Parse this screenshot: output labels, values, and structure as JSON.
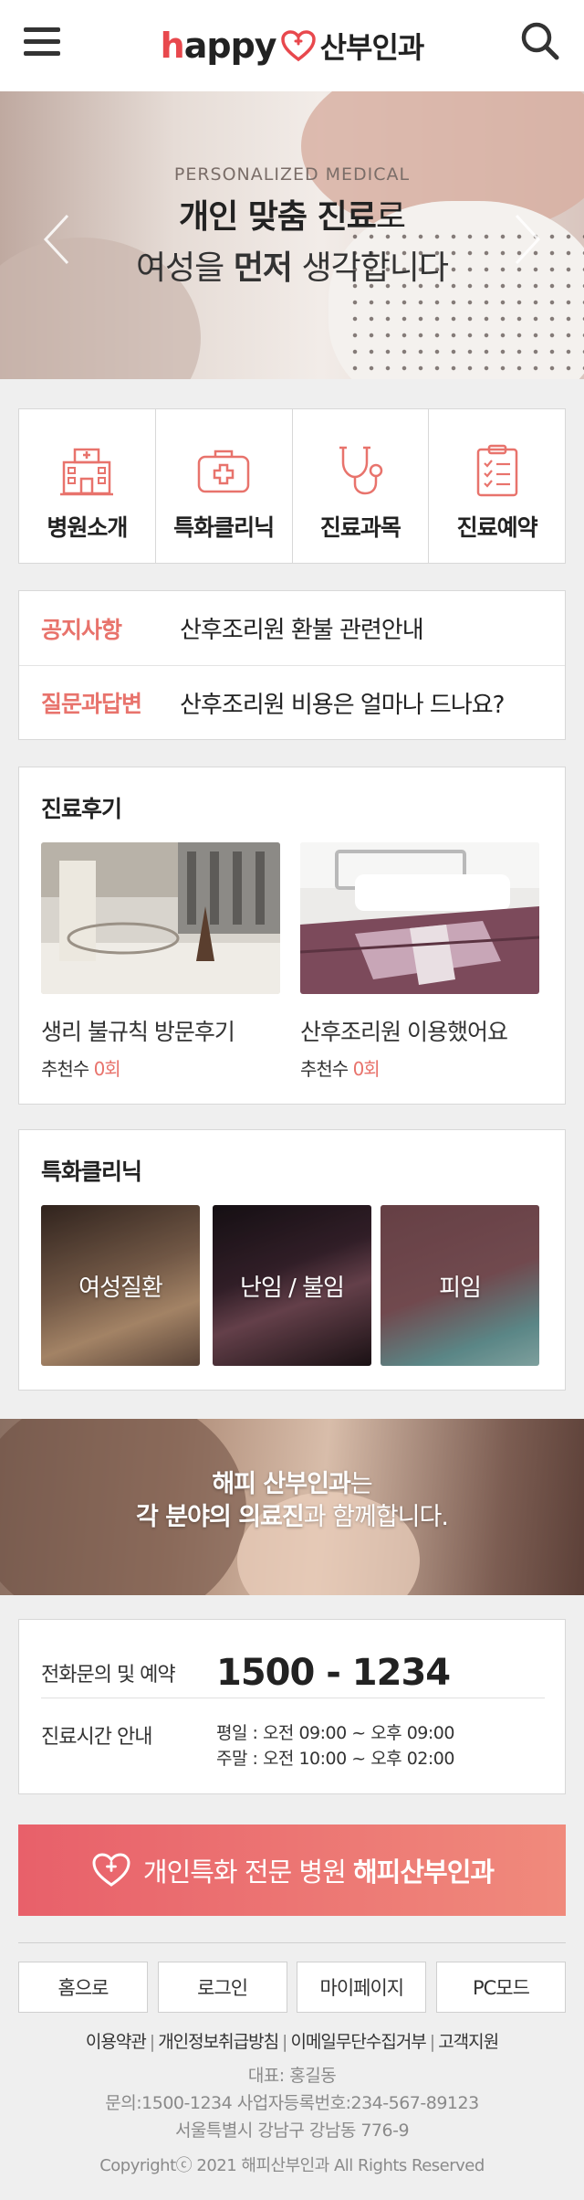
{
  "header": {
    "logo_happy_h": "h",
    "logo_happy_rest": "appy",
    "logo_ko": "산부인과"
  },
  "hero": {
    "subtitle": "PERSONALIZED MEDICAL",
    "line1_bold": "개인 맞춤 진료",
    "line1_rest": "로",
    "line2_a": "여성을 ",
    "line2_bold": "먼저",
    "line2_b": " 생각합니다"
  },
  "quick_menu": [
    {
      "label": "병원소개",
      "icon": "hospital-icon"
    },
    {
      "label": "특화클리닉",
      "icon": "medical-kit-icon"
    },
    {
      "label": "진료과목",
      "icon": "stethoscope-icon"
    },
    {
      "label": "진료예약",
      "icon": "clipboard-icon"
    }
  ],
  "notices": [
    {
      "tag": "공지사항",
      "text": "산후조리원 환불 관련안내"
    },
    {
      "tag": "질문과답변",
      "text": "산후조리원 비용은 얼마나 드나요?"
    }
  ],
  "reviews": {
    "title": "진료후기",
    "items": [
      {
        "title": "생리 불규칙 방문후기",
        "rec_label": "추천수 ",
        "rec_count": "0회"
      },
      {
        "title": "산후조리원 이용했어요",
        "rec_label": "추천수 ",
        "rec_count": "0회"
      }
    ]
  },
  "clinic": {
    "title": "특화클리닉",
    "items": [
      "여성질환",
      "난임 / 불임",
      "피임"
    ]
  },
  "banner": {
    "bold1": "해피 산부인과",
    "rest1": "는",
    "bold2": "각 분야의 의료진",
    "rest2": "과 함께합니다."
  },
  "contact": {
    "phone_label": "전화문의 및 예약",
    "phone": "1500 - 1234",
    "hours_label": "진료시간 안내",
    "weekday": "평일 : 오전 09:00 ~ 오후 09:00",
    "weekend": "주말 : 오전 10:00 ~ 오후 02:00"
  },
  "cta": {
    "text_a": "개인특화 전문 병원 ",
    "text_bold": "해피산부인과"
  },
  "footer": {
    "buttons": [
      "홈으로",
      "로그인",
      "마이페이지",
      "PC모드"
    ],
    "links": [
      "이용약관",
      "개인정보취급방침",
      "이메일무단수집거부",
      "고객지원"
    ],
    "ceo": "대표: 홍길동",
    "contact": "문의:1500-1234 사업자등록번호:234-567-89123",
    "address": "서울특별시 강남구 강남동 776-9",
    "copyright": "Copyrightⓒ 2021 해피산부인과 All Rights Reserved"
  },
  "colors": {
    "accent": "#e8736c",
    "cta_start": "#e8606a",
    "cta_end": "#f08a7c",
    "logo_red": "#e8484d"
  }
}
